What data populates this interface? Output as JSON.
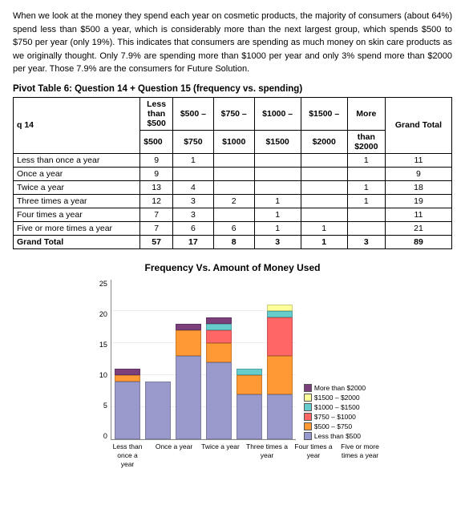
{
  "paragraph": "When we look at the money they spend each year on cosmetic products, the majority of consumers (about 64%) spend less than $500 a year, which is considerably more than the next largest group, which spends $500 to $750 per year (only 19%). This indicates that consumers are spending as much money on skin care products as we originally thought. Only 7.9% are spending more than $1000 per year and only 3% spend more than $2000 per year. Those 7.9% are the consumers for Future Solution.",
  "table": {
    "title": "Pivot Table 6: Question 14 + Question 15 (frequency vs. spending)",
    "headers": [
      "q 14",
      "Less than $500",
      "$500 – $750",
      "$750 – $1000",
      "$1000 – $1500",
      "$1500 – $2000",
      "More than $2000",
      "Grand Total"
    ],
    "rows": [
      [
        "Less than once a year",
        "9",
        "1",
        "",
        "",
        "",
        "1",
        "11"
      ],
      [
        "Once a year",
        "9",
        "",
        "",
        "",
        "",
        "",
        "9"
      ],
      [
        "Twice a year",
        "13",
        "4",
        "",
        "",
        "",
        "1",
        "18"
      ],
      [
        "Three times a year",
        "12",
        "3",
        "2",
        "1",
        "",
        "1",
        "19"
      ],
      [
        "Four times a year",
        "7",
        "3",
        "",
        "1",
        "",
        "",
        "11"
      ],
      [
        "Five or more times a year",
        "7",
        "6",
        "6",
        "1",
        "1",
        "",
        "21"
      ],
      [
        "Grand Total",
        "57",
        "17",
        "8",
        "3",
        "1",
        "3",
        "89"
      ]
    ]
  },
  "chart": {
    "title": "Frequency Vs. Amount of Money Used",
    "y_axis_labels": [
      "0",
      "5",
      "10",
      "15",
      "20",
      "25"
    ],
    "bars": [
      {
        "label": "Less than once a\nyear",
        "segments": {
          "less500": 9,
          "500_750": 1,
          "750_1000": 0,
          "1000_1500": 0,
          "1500_2000": 0,
          "more2000": 1
        },
        "total": 11
      },
      {
        "label": "Once a year",
        "segments": {
          "less500": 9,
          "500_750": 0,
          "750_1000": 0,
          "1000_1500": 0,
          "1500_2000": 0,
          "more2000": 0
        },
        "total": 9
      },
      {
        "label": "Twice a year",
        "segments": {
          "less500": 13,
          "500_750": 4,
          "750_1000": 0,
          "1000_1500": 0,
          "1500_2000": 0,
          "more2000": 1
        },
        "total": 18
      },
      {
        "label": "Three times a\nyear",
        "segments": {
          "less500": 12,
          "500_750": 3,
          "750_1000": 2,
          "1000_1500": 1,
          "1500_2000": 0,
          "more2000": 1
        },
        "total": 19
      },
      {
        "label": "Four times a\nyear",
        "segments": {
          "less500": 7,
          "500_750": 3,
          "750_1000": 0,
          "1000_1500": 1,
          "1500_2000": 0,
          "more2000": 0
        },
        "total": 11
      },
      {
        "label": "Five or more\ntimes a year",
        "segments": {
          "less500": 7,
          "500_750": 6,
          "750_1000": 6,
          "1000_1500": 1,
          "1500_2000": 1,
          "more2000": 0
        },
        "total": 21
      }
    ],
    "legend": [
      {
        "label": "More than $2000",
        "color": "#7B3F7B"
      },
      {
        "label": "$1500 – $2000",
        "color": "#FFFF99"
      },
      {
        "label": "$1000 – $1500",
        "color": "#66CCCC"
      },
      {
        "label": "$750 – $1000",
        "color": "#FF6666"
      },
      {
        "label": "$500 – $750",
        "color": "#FF9933"
      },
      {
        "label": "Less than $500",
        "color": "#9999CC"
      }
    ]
  }
}
